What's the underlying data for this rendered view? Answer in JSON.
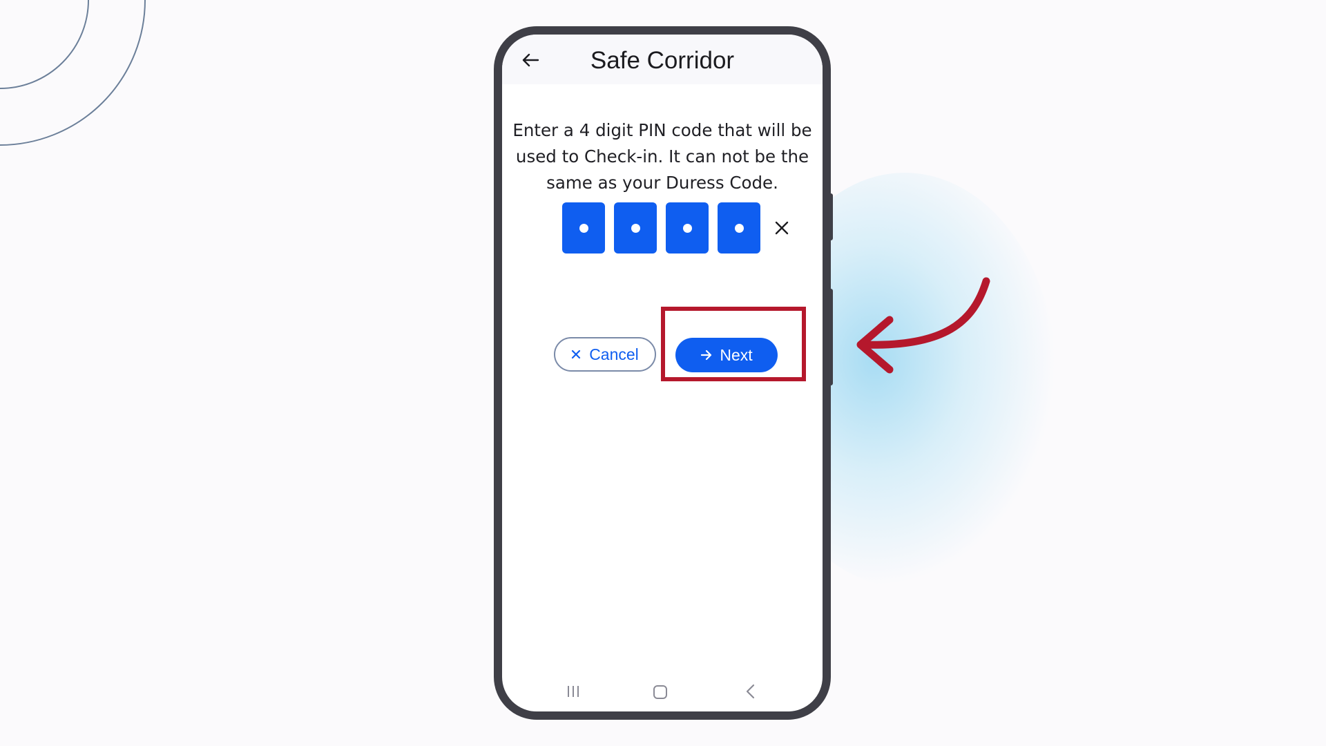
{
  "app": {
    "title": "Safe Corridor"
  },
  "pin_entry": {
    "instruction": "Enter a 4 digit PIN code that will be used to Check-in. It can not be the same as your Duress Code.",
    "digits": [
      "•",
      "•",
      "•",
      "•"
    ],
    "digits_filled": 4,
    "digits_total": 4
  },
  "actions": {
    "cancel_label": "Cancel",
    "next_label": "Next"
  },
  "icons": {
    "back": "arrow-left-icon",
    "clear": "close-icon",
    "cancel": "close-icon",
    "next": "arrow-right-icon",
    "nav_recent": "recent-apps-icon",
    "nav_home": "home-icon",
    "nav_back": "chevron-left-icon"
  },
  "colors": {
    "accent": "#0f5ef0",
    "highlight": "#b5182c",
    "phone_frame": "#3f3f47",
    "background": "#fbfafc"
  }
}
